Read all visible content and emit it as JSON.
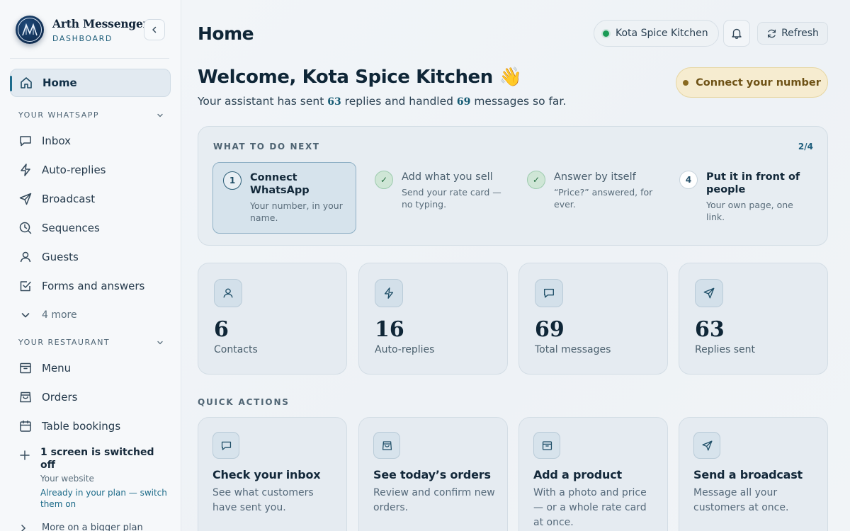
{
  "brand": {
    "title": "Arth Messenger",
    "subtitle": "DASHBOARD"
  },
  "sidebar": {
    "home": "Home",
    "whatsapp_section": "YOUR WHATSAPP",
    "whatsapp_items": [
      {
        "label": "Inbox",
        "icon": "chat-bubble-icon"
      },
      {
        "label": "Auto-replies",
        "icon": "lightning-icon"
      },
      {
        "label": "Broadcast",
        "icon": "send-icon"
      },
      {
        "label": "Sequences",
        "icon": "clock-search-icon"
      },
      {
        "label": "Guests",
        "icon": "user-icon"
      },
      {
        "label": "Forms and answers",
        "icon": "checkbox-icon"
      }
    ],
    "more": "4 more",
    "restaurant_section": "YOUR RESTAURANT",
    "restaurant_items": [
      {
        "label": "Menu",
        "icon": "archive-icon"
      },
      {
        "label": "Orders",
        "icon": "bag-icon"
      },
      {
        "label": "Table bookings",
        "icon": "calendar-icon"
      }
    ],
    "upsell": {
      "title": "1 screen is switched off",
      "subtitle": "Your website",
      "link": "Already in your plan — switch them on"
    },
    "bigger_plan": "More on a bigger plan"
  },
  "header": {
    "title": "Home",
    "store": "Kota Spice Kitchen",
    "refresh": "Refresh"
  },
  "welcome": {
    "title": "Welcome, Kota Spice Kitchen 👋",
    "prefix": "Your assistant has sent",
    "replies": "63",
    "middle": "replies and handled",
    "messages": "69",
    "suffix": "messages so far.",
    "connect_button": "Connect your number"
  },
  "next_steps": {
    "label": "WHAT TO DO NEXT",
    "progress": "2/4",
    "steps": [
      {
        "badge": "1",
        "status": "current",
        "title": "Connect WhatsApp",
        "desc": "Your number, in your name."
      },
      {
        "badge": "✓",
        "status": "done",
        "title": "Add what you sell",
        "desc": "Send your rate card — no typing."
      },
      {
        "badge": "✓",
        "status": "done",
        "title": "Answer by itself",
        "desc": "“Price?” answered, for ever."
      },
      {
        "badge": "4",
        "status": "open",
        "title": "Put it in front of people",
        "desc": "Your own page, one link."
      }
    ]
  },
  "stats": [
    {
      "value": "6",
      "label": "Contacts",
      "icon": "user-icon"
    },
    {
      "value": "16",
      "label": "Auto-replies",
      "icon": "lightning-icon"
    },
    {
      "value": "69",
      "label": "Total messages",
      "icon": "chat-bubble-icon"
    },
    {
      "value": "63",
      "label": "Replies sent",
      "icon": "send-icon"
    }
  ],
  "quick_actions": {
    "label": "QUICK ACTIONS",
    "items": [
      {
        "title": "Check your inbox",
        "desc": "See what customers have sent you.",
        "icon": "chat-bubble-icon"
      },
      {
        "title": "See today’s orders",
        "desc": "Review and confirm new orders.",
        "icon": "bag-icon"
      },
      {
        "title": "Add a product",
        "desc": "With a photo and price — or a whole rate card at once.",
        "icon": "archive-icon"
      },
      {
        "title": "Send a broadcast",
        "desc": "Message all your customers at once.",
        "icon": "send-icon"
      }
    ]
  },
  "colors": {
    "accent": "#1d6b8c",
    "status_green": "#1a9b55",
    "connect_amber": "#f6ecd0"
  }
}
